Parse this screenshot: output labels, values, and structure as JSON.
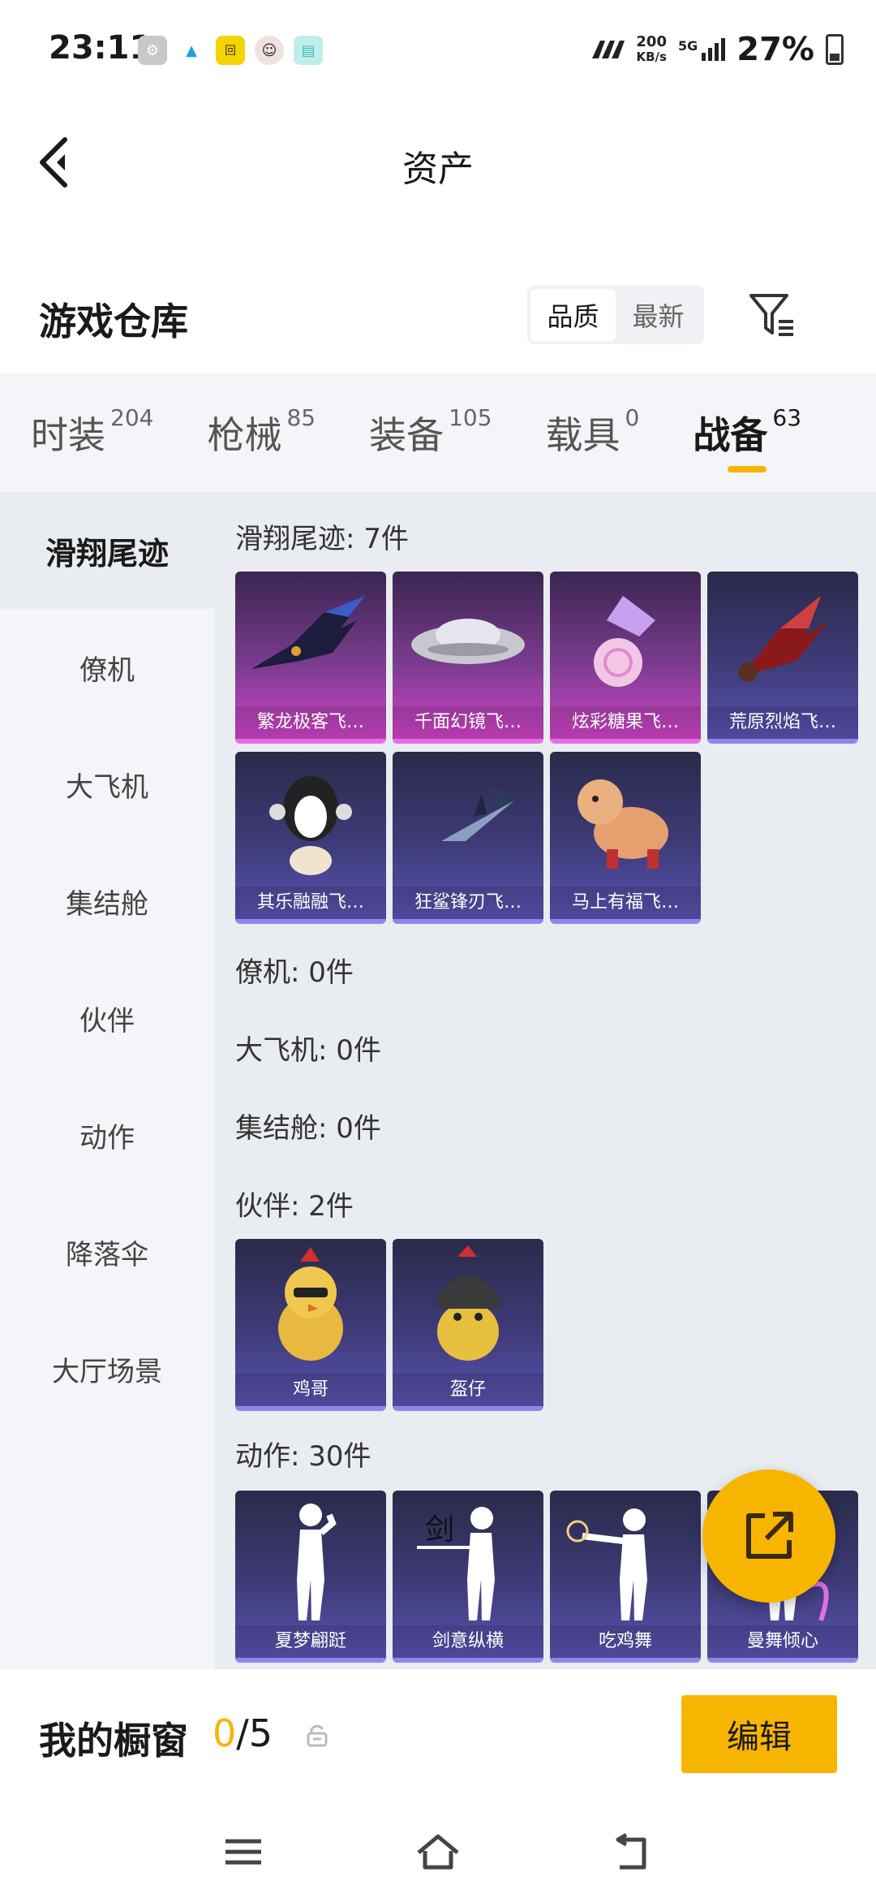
{
  "status_bar": {
    "time": "23:11",
    "speed_value": "200",
    "speed_unit": "KB/s",
    "network": "5G",
    "battery": "27%"
  },
  "header": {
    "title": "资产"
  },
  "section": {
    "title": "游戏仓库",
    "sort_options": [
      "品质",
      "最新"
    ],
    "active_sort": "品质"
  },
  "tabs": [
    {
      "label": "时装",
      "count": "204"
    },
    {
      "label": "枪械",
      "count": "85"
    },
    {
      "label": "装备",
      "count": "105"
    },
    {
      "label": "载具",
      "count": "0"
    },
    {
      "label": "战备",
      "count": "63"
    }
  ],
  "active_tab": "战备",
  "sidebar": {
    "items": [
      "滑翔尾迹",
      "僚机",
      "大飞机",
      "集结舱",
      "伙伴",
      "动作",
      "降落伞",
      "大厅场景"
    ],
    "active": "滑翔尾迹"
  },
  "groups": [
    {
      "title": "滑翔尾迹: 7件",
      "items": [
        {
          "name": "繁龙极客飞…",
          "rarity": "purple"
        },
        {
          "name": "千面幻镜飞…",
          "rarity": "purple"
        },
        {
          "name": "炫彩糖果飞…",
          "rarity": "purple"
        },
        {
          "name": "荒原烈焰飞…",
          "rarity": "blue"
        },
        {
          "name": "其乐融融飞…",
          "rarity": "blue"
        },
        {
          "name": "狂鲨锋刃飞…",
          "rarity": "blue"
        },
        {
          "name": "马上有福飞…",
          "rarity": "blue"
        }
      ]
    },
    {
      "title": "僚机: 0件",
      "items": []
    },
    {
      "title": "大飞机: 0件",
      "items": []
    },
    {
      "title": "集结舱: 0件",
      "items": []
    },
    {
      "title": "伙伴: 2件",
      "items": [
        {
          "name": "鸡哥",
          "rarity": "blue"
        },
        {
          "name": "盔仔",
          "rarity": "blue"
        }
      ]
    },
    {
      "title": "动作: 30件",
      "items": [
        {
          "name": "夏梦翩跹",
          "rarity": "blue"
        },
        {
          "name": "剑意纵横",
          "rarity": "blue"
        },
        {
          "name": "吃鸡舞",
          "rarity": "blue"
        },
        {
          "name": "曼舞倾心",
          "rarity": "blue"
        }
      ]
    }
  ],
  "showcase": {
    "label": "我的橱窗",
    "current": "0",
    "max": "/5",
    "edit_label": "编辑"
  },
  "colors": {
    "accent": "#f7b500",
    "purple_rarity": "#d044c8",
    "blue_rarity": "#5a52b0"
  }
}
